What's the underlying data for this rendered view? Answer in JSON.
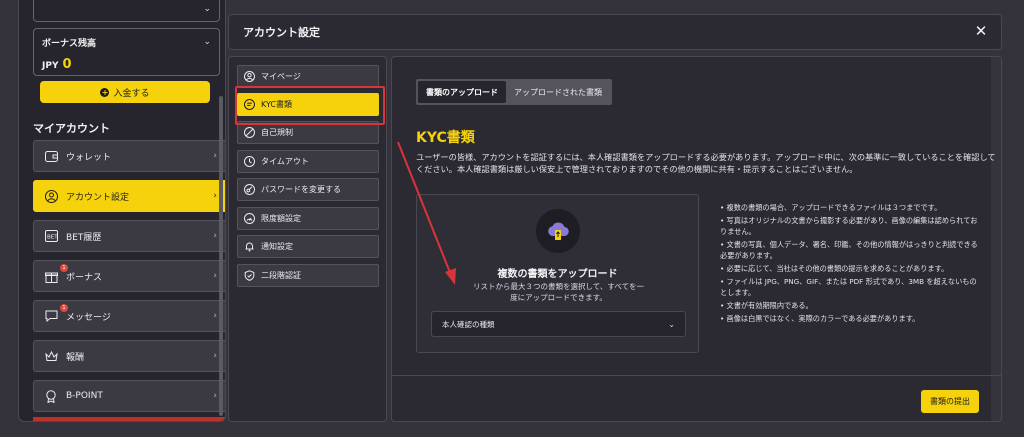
{
  "sidebar": {
    "bonus_label": "ボーナス残高",
    "bonus_currency": "JPY",
    "bonus_amount": "0",
    "deposit_label": "入金する",
    "section_title": "マイアカウント",
    "items": [
      {
        "label": "ウォレット",
        "icon": "wallet-icon"
      },
      {
        "label": "アカウント設定",
        "icon": "user-icon"
      },
      {
        "label": "BET履歴",
        "icon": "bet-history-icon"
      },
      {
        "label": "ボーナス",
        "icon": "gift-icon",
        "badge": "1"
      },
      {
        "label": "メッセージ",
        "icon": "message-icon",
        "badge": "1"
      },
      {
        "label": "報酬",
        "icon": "crown-icon"
      },
      {
        "label": "B-POINT",
        "icon": "medal-icon"
      }
    ]
  },
  "modal": {
    "title": "アカウント設定",
    "close_symbol": "✕"
  },
  "settings_nav": [
    {
      "label": "マイページ",
      "icon": "user-circle-icon"
    },
    {
      "label": "KYC書類",
      "icon": "document-icon"
    },
    {
      "label": "自己規制",
      "icon": "block-icon"
    },
    {
      "label": "タイムアウト",
      "icon": "clock-icon"
    },
    {
      "label": "パスワードを変更する",
      "icon": "key-icon"
    },
    {
      "label": "限度額設定",
      "icon": "limit-icon"
    },
    {
      "label": "通知設定",
      "icon": "bell-icon"
    },
    {
      "label": "二段階認証",
      "icon": "shield-check-icon"
    }
  ],
  "content": {
    "tabs": [
      "書類のアップロード",
      "アップロードされた書類"
    ],
    "heading": "KYC書類",
    "description": "ユーザーの皆様、アカウントを認証するには、本人確認書類をアップロードする必要があります。アップロード中に、次の基準に一致していることを確認してください。本人確認書類は厳しい保安上で管理されておりますのでその他の機関に共有・提示することはございません。",
    "upload_title": "複数の書類をアップロード",
    "upload_subtitle": "リストから最大３つの書類を選択して、すべてを一度にアップロードできます。",
    "select_placeholder": "本人確認の種類",
    "rules": [
      "複数の書類の場合、アップロードできるファイルは３つまでです。",
      "写真はオリジナルの文書から撮影する必要があり、画像の編集は認められておりません。",
      "文書の写真、個人データ、署名、印鑑、その他の情報がはっきりと判読できる必要があります。",
      "必要に応じて、当社はその他の書類の提示を求めることがあります。",
      "ファイルは JPG、PNG、GIF、または PDF 形式であり、3MB を超えないものとします。",
      "文書が有効期限内である。",
      "画像は白黒ではなく、実際のカラーである必要があります。"
    ],
    "submit_label": "書類の提出"
  },
  "colors": {
    "accent": "#f5d20c",
    "highlight": "#d9343a",
    "panel": "#2b2a32",
    "background": "#34333b"
  }
}
